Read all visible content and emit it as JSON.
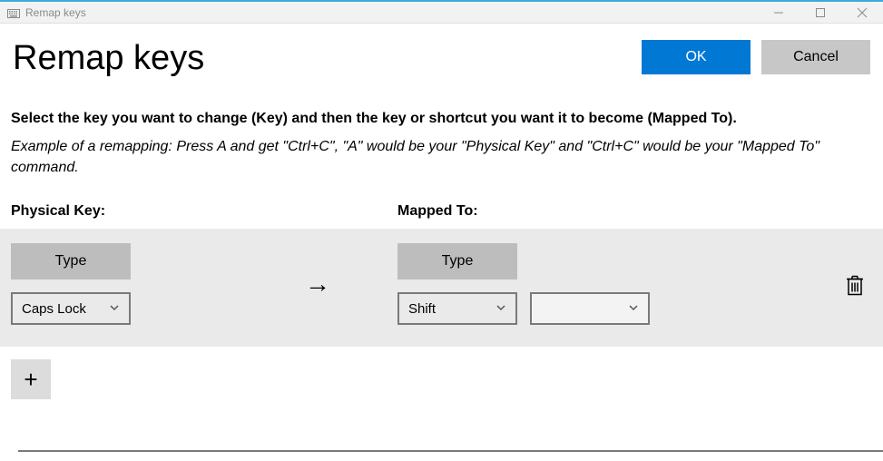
{
  "window": {
    "title": "Remap keys",
    "controls": {
      "minimize": "–",
      "maximize": "▢",
      "close": "×"
    }
  },
  "header": {
    "page_title": "Remap keys",
    "ok_label": "OK",
    "cancel_label": "Cancel"
  },
  "instructions": {
    "main": "Select the key you want to change (Key) and then the key or shortcut you want it to become (Mapped To).",
    "example": "Example of a remapping: Press A and get \"Ctrl+C\", \"A\" would be your \"Physical Key\" and \"Ctrl+C\" would be your \"Mapped To\" command."
  },
  "columns": {
    "physical": "Physical Key:",
    "mapped": "Mapped To:"
  },
  "row": {
    "type_label": "Type",
    "physical_key": "Caps Lock",
    "mapped_key_1": "Shift",
    "mapped_key_2": ""
  },
  "icons": {
    "arrow_right": "→",
    "plus": "+"
  }
}
